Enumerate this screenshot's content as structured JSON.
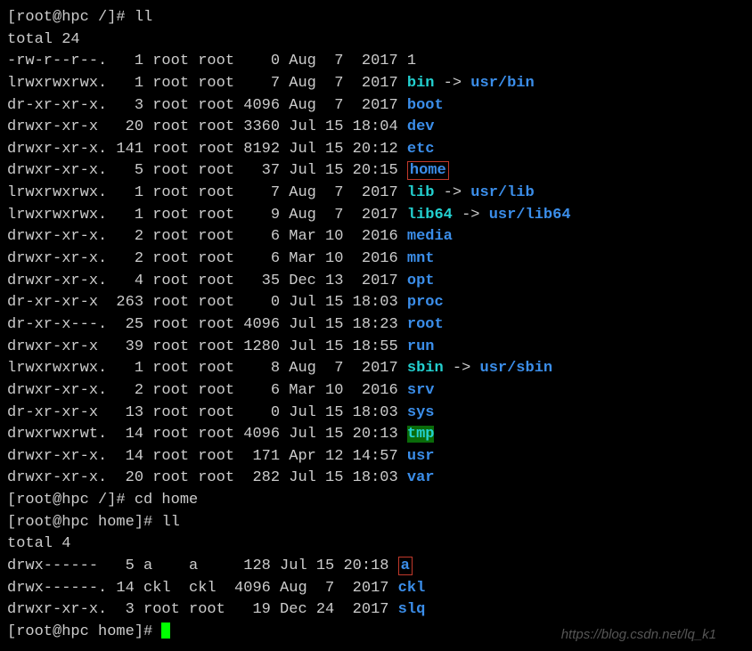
{
  "prompt1": "[root@hpc /]# ",
  "cmd1": "ll",
  "total1": "total 24",
  "rows1": [
    {
      "perm": "-rw-r--r--.",
      "lnk": "   1",
      "own": "root",
      "grp": "root",
      "size": "    0",
      "date": "Aug  7  2017",
      "name": "1",
      "type": "plain"
    },
    {
      "perm": "lrwxrwxrwx.",
      "lnk": "   1",
      "own": "root",
      "grp": "root",
      "size": "    7",
      "date": "Aug  7  2017",
      "name": "bin",
      "type": "link",
      "target": "usr/bin",
      "ttype": "dir"
    },
    {
      "perm": "dr-xr-xr-x.",
      "lnk": "   3",
      "own": "root",
      "grp": "root",
      "size": " 4096",
      "date": "Aug  7  2017",
      "name": "boot",
      "type": "dir"
    },
    {
      "perm": "drwxr-xr-x ",
      "lnk": "  20",
      "own": "root",
      "grp": "root",
      "size": " 3360",
      "date": "Jul 15 18:04",
      "name": "dev",
      "type": "dir"
    },
    {
      "perm": "drwxr-xr-x.",
      "lnk": " 141",
      "own": "root",
      "grp": "root",
      "size": " 8192",
      "date": "Jul 15 20:12",
      "name": "etc",
      "type": "dir"
    },
    {
      "perm": "drwxr-xr-x.",
      "lnk": "   5",
      "own": "root",
      "grp": "root",
      "size": "   37",
      "date": "Jul 15 20:15",
      "name": "home",
      "type": "dir",
      "boxed": true
    },
    {
      "perm": "lrwxrwxrwx.",
      "lnk": "   1",
      "own": "root",
      "grp": "root",
      "size": "    7",
      "date": "Aug  7  2017",
      "name": "lib",
      "type": "link",
      "target": "usr/lib",
      "ttype": "dir"
    },
    {
      "perm": "lrwxrwxrwx.",
      "lnk": "   1",
      "own": "root",
      "grp": "root",
      "size": "    9",
      "date": "Aug  7  2017",
      "name": "lib64",
      "type": "link",
      "target": "usr/lib64",
      "ttype": "dir"
    },
    {
      "perm": "drwxr-xr-x.",
      "lnk": "   2",
      "own": "root",
      "grp": "root",
      "size": "    6",
      "date": "Mar 10  2016",
      "name": "media",
      "type": "dir"
    },
    {
      "perm": "drwxr-xr-x.",
      "lnk": "   2",
      "own": "root",
      "grp": "root",
      "size": "    6",
      "date": "Mar 10  2016",
      "name": "mnt",
      "type": "dir"
    },
    {
      "perm": "drwxr-xr-x.",
      "lnk": "   4",
      "own": "root",
      "grp": "root",
      "size": "   35",
      "date": "Dec 13  2017",
      "name": "opt",
      "type": "dir"
    },
    {
      "perm": "dr-xr-xr-x ",
      "lnk": " 263",
      "own": "root",
      "grp": "root",
      "size": "    0",
      "date": "Jul 15 18:03",
      "name": "proc",
      "type": "dir"
    },
    {
      "perm": "dr-xr-x---.",
      "lnk": "  25",
      "own": "root",
      "grp": "root",
      "size": " 4096",
      "date": "Jul 15 18:23",
      "name": "root",
      "type": "dir"
    },
    {
      "perm": "drwxr-xr-x ",
      "lnk": "  39",
      "own": "root",
      "grp": "root",
      "size": " 1280",
      "date": "Jul 15 18:55",
      "name": "run",
      "type": "dir"
    },
    {
      "perm": "lrwxrwxrwx.",
      "lnk": "   1",
      "own": "root",
      "grp": "root",
      "size": "    8",
      "date": "Aug  7  2017",
      "name": "sbin",
      "type": "link",
      "target": "usr/sbin",
      "ttype": "dir"
    },
    {
      "perm": "drwxr-xr-x.",
      "lnk": "   2",
      "own": "root",
      "grp": "root",
      "size": "    6",
      "date": "Mar 10  2016",
      "name": "srv",
      "type": "dir"
    },
    {
      "perm": "dr-xr-xr-x ",
      "lnk": "  13",
      "own": "root",
      "grp": "root",
      "size": "    0",
      "date": "Jul 15 18:03",
      "name": "sys",
      "type": "dir"
    },
    {
      "perm": "drwxrwxrwt.",
      "lnk": "  14",
      "own": "root",
      "grp": "root",
      "size": " 4096",
      "date": "Jul 15 20:13",
      "name": "tmp",
      "type": "sticky"
    },
    {
      "perm": "drwxr-xr-x.",
      "lnk": "  14",
      "own": "root",
      "grp": "root",
      "size": "  171",
      "date": "Apr 12 14:57",
      "name": "usr",
      "type": "dir"
    },
    {
      "perm": "drwxr-xr-x.",
      "lnk": "  20",
      "own": "root",
      "grp": "root",
      "size": "  282",
      "date": "Jul 15 18:03",
      "name": "var",
      "type": "dir"
    }
  ],
  "prompt2": "[root@hpc /]# ",
  "cmd2": "cd home",
  "prompt3": "[root@hpc home]# ",
  "cmd3": "ll",
  "total2": "total 4",
  "rows2": [
    {
      "perm": "drwx------ ",
      "lnk": "  5",
      "own": "a   ",
      "grp": "a   ",
      "size": "  128",
      "date": "Jul 15 20:18",
      "name": "a",
      "type": "dir",
      "boxed": true
    },
    {
      "perm": "drwx------.",
      "lnk": " 14",
      "own": "ckl ",
      "grp": "ckl ",
      "size": " 4096",
      "date": "Aug  7  2017",
      "name": "ckl",
      "type": "dir"
    },
    {
      "perm": "drwxr-xr-x.",
      "lnk": "  3",
      "own": "root",
      "grp": "root",
      "size": "   19",
      "date": "Dec 24  2017",
      "name": "slq",
      "type": "dir"
    }
  ],
  "prompt4": "[root@hpc home]# ",
  "watermark": "https://blog.csdn.net/lq_k1"
}
